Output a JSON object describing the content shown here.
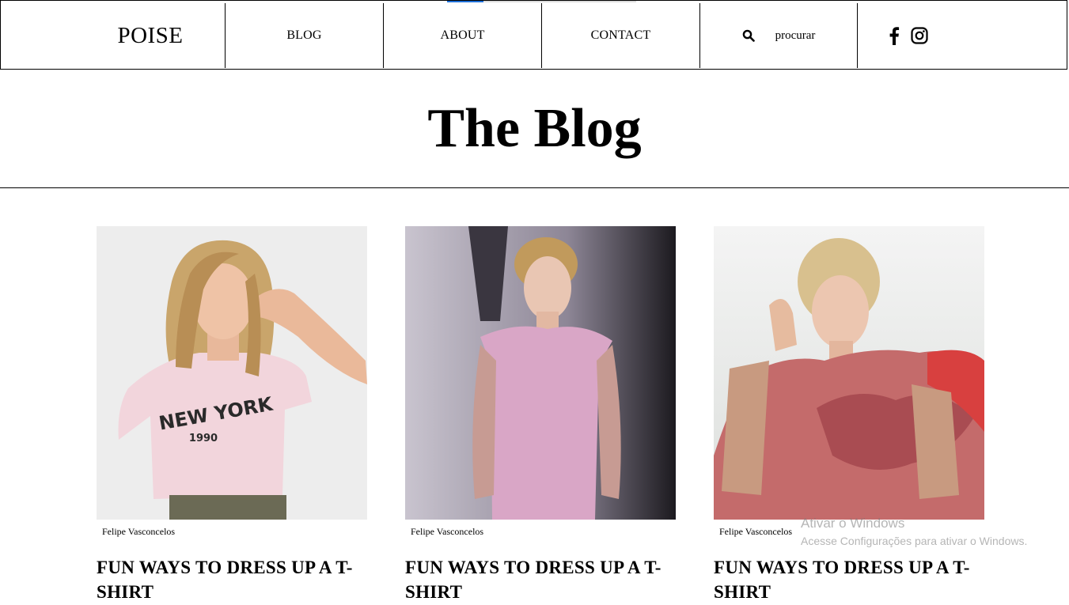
{
  "nav": {
    "logo": "POISE",
    "links": [
      {
        "label": "BLOG"
      },
      {
        "label": "ABOUT"
      },
      {
        "label": "CONTACT"
      }
    ],
    "search": {
      "icon": "search-icon",
      "label": "procurar"
    },
    "social": [
      {
        "icon": "facebook-icon"
      },
      {
        "icon": "instagram-icon"
      }
    ],
    "accent_color": "#1e6fd9"
  },
  "page": {
    "title": "The Blog"
  },
  "posts": [
    {
      "author": "Felipe Vasconcelos",
      "title": "FUN WAYS TO DRESS UP A T-SHIRT",
      "image": "woman-pink-new-york-tshirt-photo",
      "shirt_text": "NEW YORK",
      "shirt_year": "1990"
    },
    {
      "author": "Felipe Vasconcelos",
      "title": "FUN WAYS TO DRESS UP A T-SHIRT",
      "image": "runway-model-pink-dress-photo"
    },
    {
      "author": "Felipe Vasconcelos",
      "title": "FUN WAYS TO DRESS UP A T-SHIRT",
      "image": "woman-pink-ruffle-dress-photo"
    }
  ],
  "watermark": {
    "title": "Ativar o Windows",
    "subtitle": "Acesse Configurações para ativar o Windows."
  }
}
